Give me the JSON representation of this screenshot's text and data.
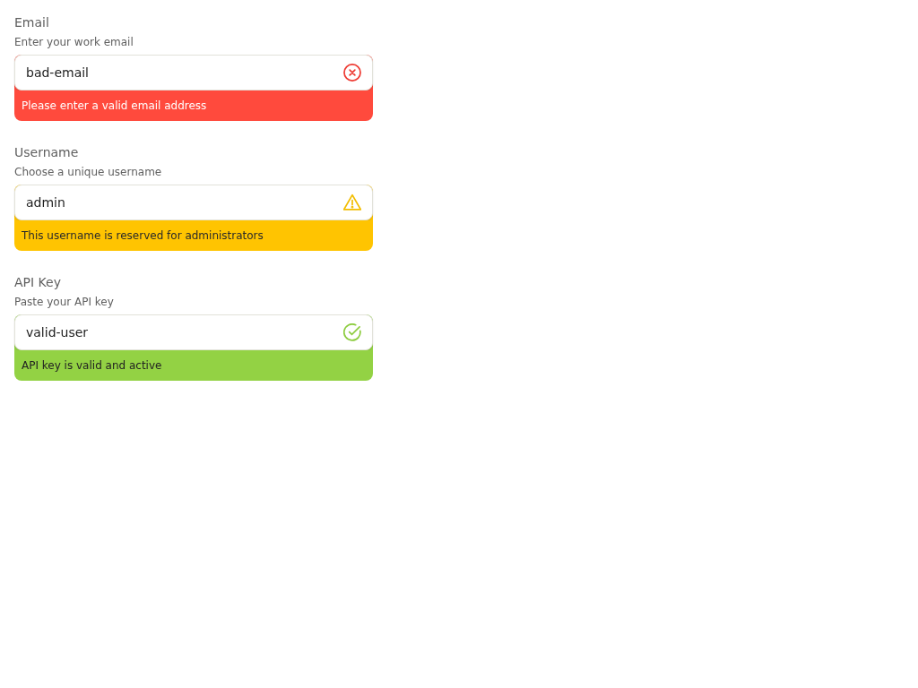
{
  "fields": [
    {
      "label": "Email",
      "helper": "Enter your work email",
      "value": "bad-email",
      "kind": "error",
      "message": "Please enter a valid email address"
    },
    {
      "label": "Username",
      "helper": "Choose a unique username",
      "value": "admin",
      "kind": "warning",
      "message": "This username is reserved for administrators"
    },
    {
      "label": "API Key",
      "helper": "Paste your API key",
      "value": "valid-user",
      "kind": "success",
      "message": "API key is valid and active"
    }
  ]
}
